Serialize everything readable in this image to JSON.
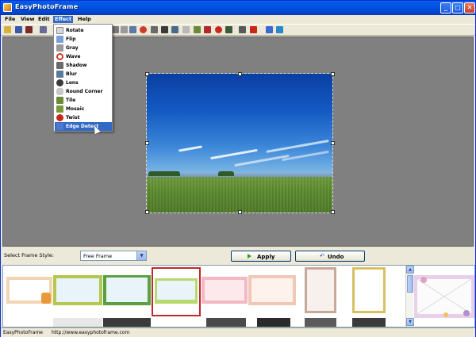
{
  "window": {
    "title": "EasyPhotoFrame",
    "min_symbol": "_",
    "max_symbol": "□",
    "close_symbol": "✕"
  },
  "menubar": {
    "items": [
      {
        "label": "File"
      },
      {
        "label": "View"
      },
      {
        "label": "Edit"
      },
      {
        "label": "Effect"
      },
      {
        "label": "Help"
      }
    ],
    "active": "Effect"
  },
  "effect_menu": {
    "items": [
      {
        "label": "Rotate",
        "icon": "rotate-icon",
        "color": "#d8d8d8"
      },
      {
        "label": "Flip",
        "icon": "flip-icon",
        "color": "#7aa0d8"
      },
      {
        "label": "Gray",
        "icon": "gray-icon",
        "color": "#9a9a9a"
      },
      {
        "label": "Wave",
        "icon": "wave-icon",
        "color": "#d03a2a"
      },
      {
        "label": "Shadow",
        "icon": "shadow-icon",
        "color": "#6a6a6a"
      },
      {
        "label": "Blur",
        "icon": "blur-icon",
        "color": "#5a7a9a"
      },
      {
        "label": "Lens",
        "icon": "lens-icon",
        "color": "#3a3a3a"
      },
      {
        "label": "Round Corner",
        "icon": "round-corner-icon",
        "color": "#c8c8c8"
      },
      {
        "label": "Tile",
        "icon": "tile-icon",
        "color": "#6a8a3a"
      },
      {
        "label": "Mosaic",
        "icon": "mosaic-icon",
        "color": "#7a9a3a"
      },
      {
        "label": "Twist",
        "icon": "twist-icon",
        "color": "#c8281a"
      },
      {
        "label": "Edge Detect",
        "icon": "edge-detect-icon",
        "color": "#4a7ad0"
      }
    ],
    "selected": "Edge Detect"
  },
  "controls": {
    "frame_style_label": "Select Frame Style:",
    "frame_style_value": "Free Frame",
    "apply_label": "Apply",
    "undo_label": "Undo",
    "undo_symbol": "↶"
  },
  "statusbar": {
    "app_name": "EasyPhotoFrame",
    "url": "http://www.easyphotoframe.com"
  },
  "colors": {
    "titlebar": "#0054e3",
    "workspace": "#808080",
    "menu_highlight": "#316ac5",
    "selected_thumb_border": "#c0282a"
  }
}
